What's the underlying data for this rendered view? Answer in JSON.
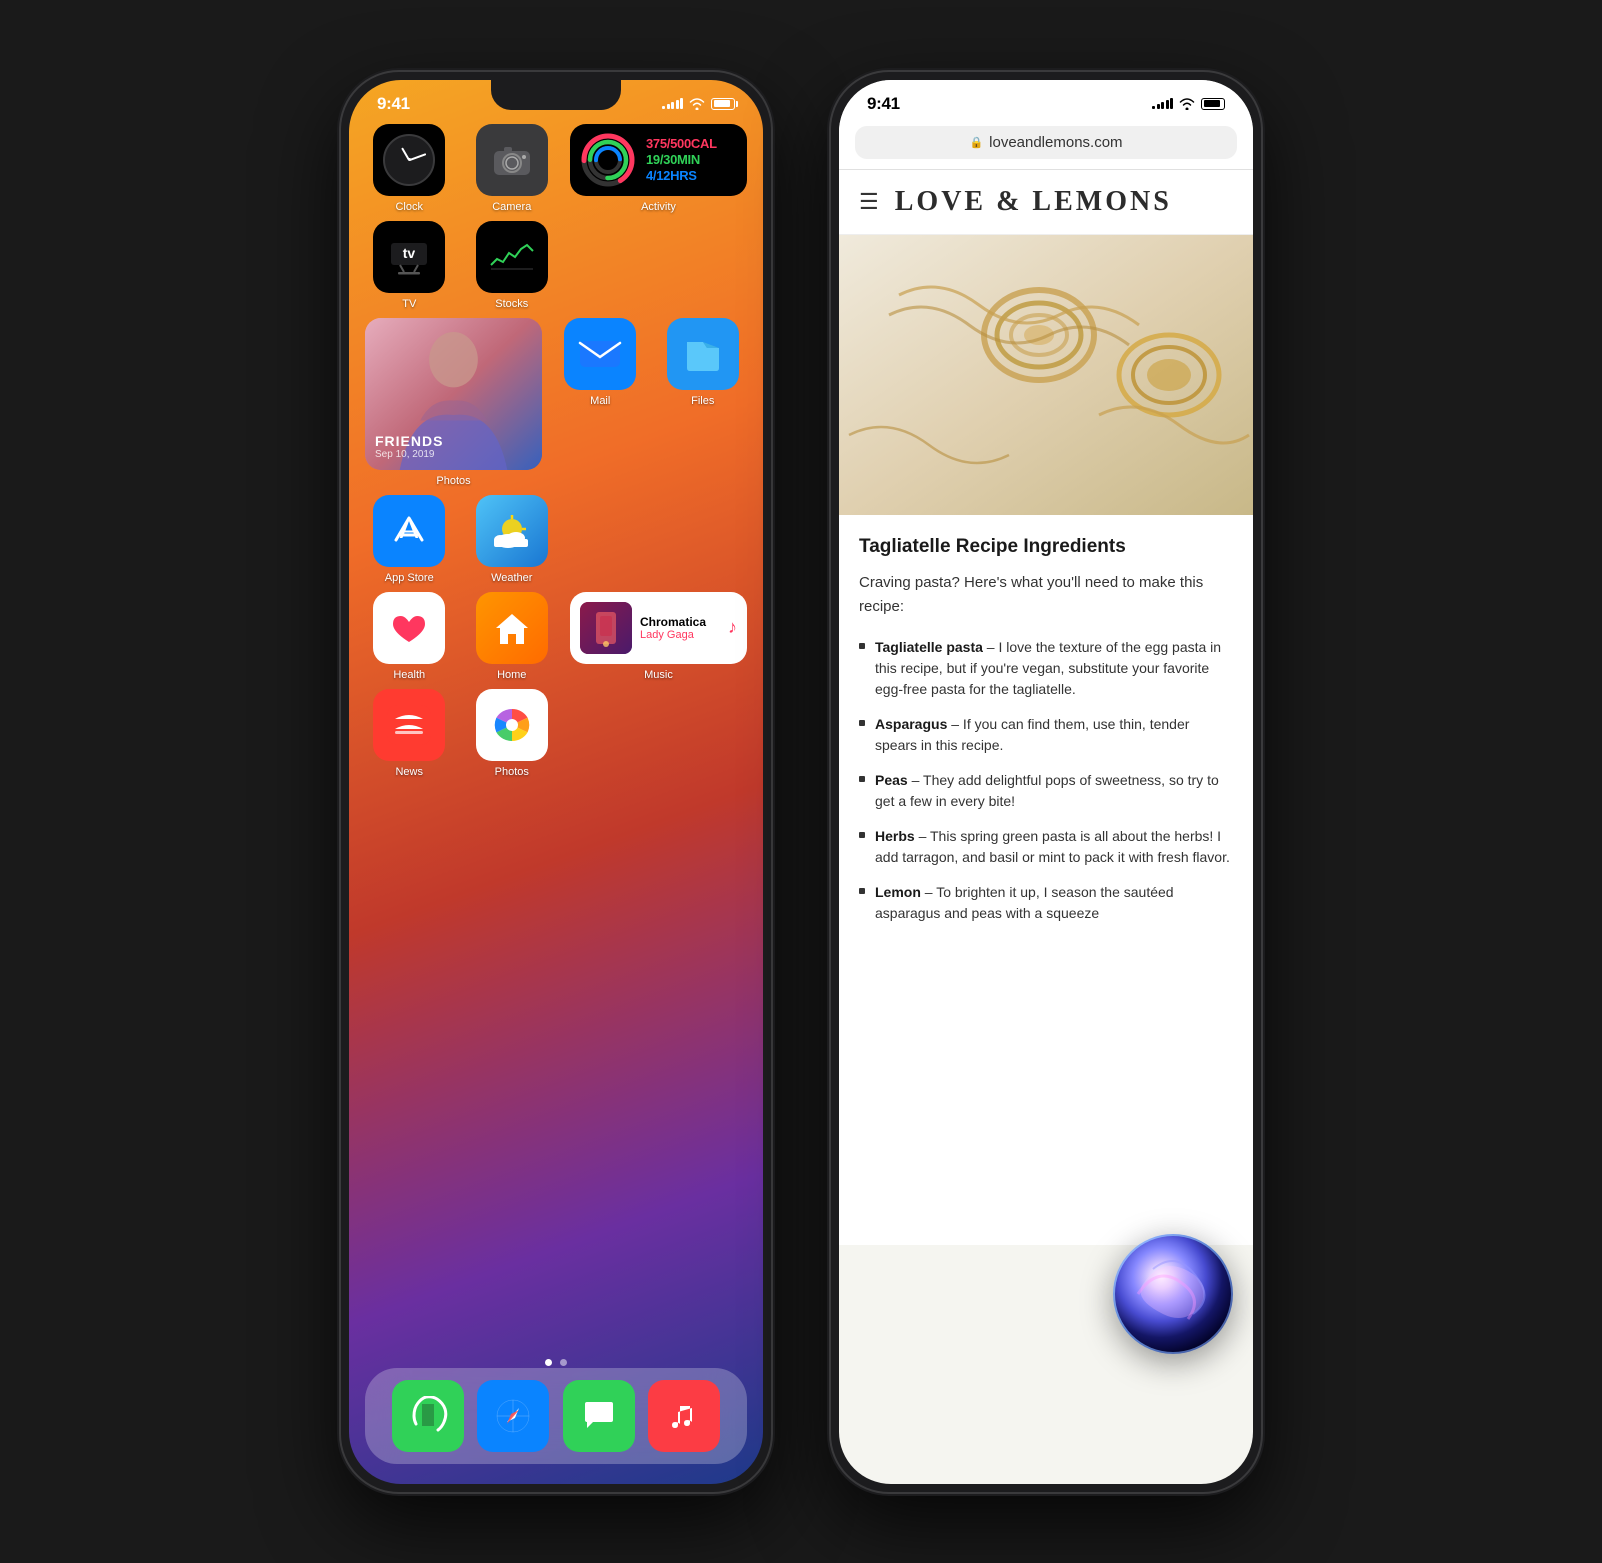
{
  "phone1": {
    "status": {
      "time": "9:41",
      "signal_bars": [
        3,
        5,
        7,
        9,
        11
      ],
      "wifi": true,
      "battery": 85
    },
    "apps_row1": [
      {
        "name": "Clock",
        "label": "Clock",
        "type": "clock"
      },
      {
        "name": "Camera",
        "label": "Camera",
        "type": "camera"
      },
      {
        "name": "Activity",
        "label": "Activity",
        "type": "activity_widget",
        "stats": {
          "cal": "375/500CAL",
          "min": "19/30MIN",
          "hrs": "4/12HRS"
        }
      }
    ],
    "apps_row2": [
      {
        "name": "TV",
        "label": "TV",
        "type": "tv"
      },
      {
        "name": "Stocks",
        "label": "Stocks",
        "type": "stocks"
      },
      {
        "name": "Activity-placeholder",
        "label": "",
        "type": "empty"
      }
    ],
    "apps_row3": [
      {
        "name": "Photos",
        "label": "Photos",
        "type": "photos_widget",
        "overlay_title": "FRIENDS",
        "overlay_date": "Sep 10, 2019"
      },
      {
        "name": "Mail",
        "label": "Mail",
        "type": "mail"
      },
      {
        "name": "Files",
        "label": "Files",
        "type": "files"
      }
    ],
    "apps_row4": [
      {
        "name": "AppStore",
        "label": "App Store",
        "type": "appstore"
      },
      {
        "name": "Weather",
        "label": "Weather",
        "type": "weather"
      }
    ],
    "apps_row5": [
      {
        "name": "Health",
        "label": "Health",
        "type": "health"
      },
      {
        "name": "Home",
        "label": "Home",
        "type": "home"
      },
      {
        "name": "Music",
        "label": "Music",
        "type": "music_widget",
        "album_title": "Chromatica",
        "artist": "Lady Gaga"
      }
    ],
    "apps_row6": [
      {
        "name": "News",
        "label": "News",
        "type": "news"
      },
      {
        "name": "Photos2",
        "label": "Photos",
        "type": "photos_app"
      }
    ],
    "dock": [
      {
        "name": "Phone",
        "label": "Phone",
        "emoji": "📞",
        "bg": "#30d158"
      },
      {
        "name": "Safari",
        "label": "Safari",
        "emoji": "🧭",
        "bg": "#0a84ff"
      },
      {
        "name": "Messages",
        "label": "Messages",
        "emoji": "💬",
        "bg": "#30d158"
      },
      {
        "name": "Music-dock",
        "label": "Music",
        "emoji": "🎵",
        "bg": "#fc3c44"
      }
    ],
    "page_dots": [
      true,
      false
    ]
  },
  "phone2": {
    "status": {
      "time": "9:41"
    },
    "address_bar": {
      "url": "loveandlemons.com",
      "secure": true,
      "lock_symbol": "🔒"
    },
    "site": {
      "title": "LOVE & LEMONS",
      "hamburger": "☰"
    },
    "article": {
      "heading": "Tagliatelle Recipe Ingredients",
      "intro": "Craving pasta? Here's what you'll need to make this recipe:",
      "ingredients": [
        {
          "bold": "Tagliatelle pasta",
          "text": " – I love the texture of the egg pasta in this recipe, but if you're vegan, substitute your favorite egg-free pasta for the tagliatelle."
        },
        {
          "bold": "Asparagus",
          "text": " – If you can find them, use thin, tender spears in this recipe."
        },
        {
          "bold": "Peas",
          "text": " – They add delightful pops of sweetness, so try to get a few in every bite!"
        },
        {
          "bold": "Herbs",
          "text": " – This spring green pasta is all about the herbs! I add tarragon, and basil or mint to pack it with fresh flavor."
        },
        {
          "bold": "Lemon",
          "text": " – To brighten it up, I season the sautéed asparagus and peas with a squeeze"
        }
      ]
    }
  }
}
